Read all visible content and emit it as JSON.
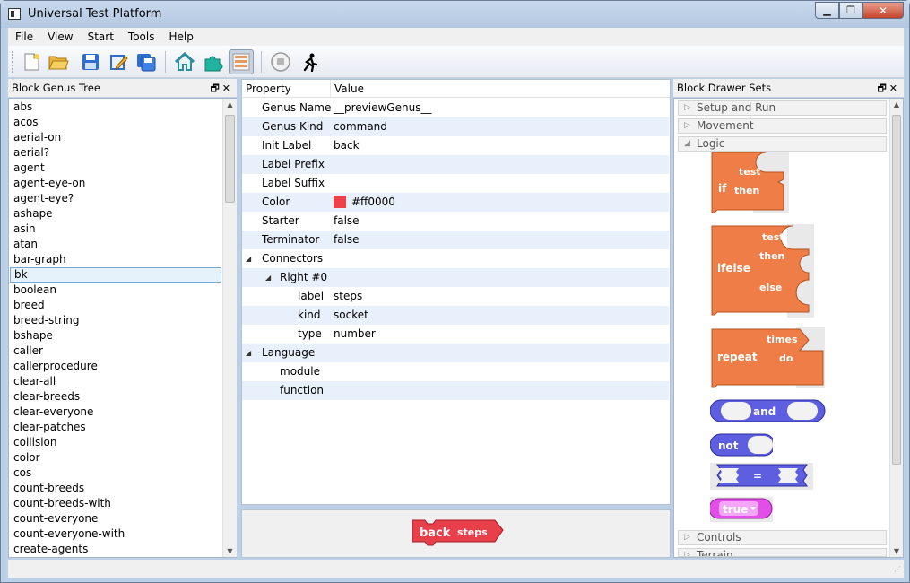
{
  "window": {
    "title": "Universal Test Platform"
  },
  "menu": [
    "File",
    "View",
    "Start",
    "Tools",
    "Help"
  ],
  "toolbar_icons": [
    "new-file-icon",
    "open-folder-icon",
    "save-icon",
    "edit-icon",
    "save-all-icon",
    "home-icon",
    "puzzle-icon",
    "list-view-icon",
    "stop-icon",
    "run-icon"
  ],
  "left_panel": {
    "title": "Block Genus Tree",
    "items": [
      "abs",
      "acos",
      "aerial-on",
      "aerial?",
      "agent",
      "agent-eye-on",
      "agent-eye?",
      "ashape",
      "asin",
      "atan",
      "bar-graph",
      "bk",
      "boolean",
      "breed",
      "breed-string",
      "bshape",
      "caller",
      "callerprocedure",
      "clear-all",
      "clear-breeds",
      "clear-everyone",
      "clear-patches",
      "collision",
      "color",
      "cos",
      "count-breeds",
      "count-breeds-with",
      "count-everyone",
      "count-everyone-with",
      "create-agents"
    ],
    "selected_index": 11
  },
  "properties": {
    "header_property": "Property",
    "header_value": "Value",
    "rows": [
      {
        "key": "Genus Name",
        "value": "__previewGenus__"
      },
      {
        "key": "Genus Kind",
        "value": "command"
      },
      {
        "key": "Init Label",
        "value": "back"
      },
      {
        "key": "Label Prefix",
        "value": ""
      },
      {
        "key": "Label Suffix",
        "value": ""
      },
      {
        "key": "Color",
        "value": "#ff0000"
      },
      {
        "key": "Starter",
        "value": "false"
      },
      {
        "key": "Terminator",
        "value": "false"
      },
      {
        "key": "Connectors",
        "value": ""
      },
      {
        "key": "Right #0",
        "value": ""
      },
      {
        "key": "label",
        "value": "steps"
      },
      {
        "key": "kind",
        "value": "socket"
      },
      {
        "key": "type",
        "value": "number"
      },
      {
        "key": "Language",
        "value": ""
      },
      {
        "key": "module",
        "value": ""
      },
      {
        "key": "function",
        "value": ""
      }
    ]
  },
  "preview_block": {
    "label": "back",
    "socket_label": "steps",
    "color": "#e8404a"
  },
  "right_panel": {
    "title": "Block Drawer Sets",
    "sections_top": [
      "Setup and Run",
      "Movement",
      "Logic"
    ],
    "sections_bottom": [
      "Controls",
      "Terrain"
    ],
    "blocks": {
      "if": {
        "label": "if",
        "test": "test",
        "then": "then",
        "color": "#ee7d47"
      },
      "ifelse": {
        "label": "ifelse",
        "test": "test",
        "then": "then",
        "else": "else",
        "color": "#ee7d47"
      },
      "repeat": {
        "label": "repeat",
        "times": "times",
        "do": "do",
        "color": "#ee7d47"
      },
      "and": {
        "label": "and",
        "color": "#5d5fe0"
      },
      "not": {
        "label": "not",
        "color": "#5d5fe0"
      },
      "equals": {
        "label": "=",
        "color": "#5d5fe0"
      },
      "true": {
        "label": "true",
        "color": "#e14fe8"
      }
    }
  },
  "colors": {
    "swatch": "#f0404a"
  }
}
